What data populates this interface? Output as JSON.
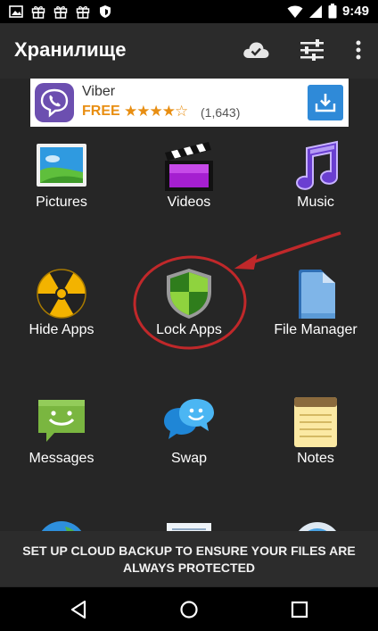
{
  "status_bar": {
    "time": "9:49",
    "left_icons": [
      "image-icon",
      "gift-icon",
      "gift-icon",
      "gift-icon",
      "shield-icon"
    ],
    "right_icons": [
      "wifi-icon",
      "signal-icon",
      "battery-icon"
    ]
  },
  "app_bar": {
    "title": "Хранилище",
    "actions": [
      "cloud-check-icon",
      "sliders-icon",
      "more-vertical-icon"
    ]
  },
  "ad": {
    "app_name": "Viber",
    "price": "FREE",
    "rating": 3.5,
    "rating_stars": "★★★★☆",
    "rating_count": "(1,643)"
  },
  "grid": [
    {
      "label": "Pictures",
      "icon": "pictures-icon"
    },
    {
      "label": "Videos",
      "icon": "videos-icon"
    },
    {
      "label": "Music",
      "icon": "music-icon"
    },
    {
      "label": "Hide Apps",
      "icon": "hide-apps-icon"
    },
    {
      "label": "Lock Apps",
      "icon": "lock-apps-icon"
    },
    {
      "label": "File Manager",
      "icon": "file-manager-icon"
    },
    {
      "label": "Messages",
      "icon": "messages-icon"
    },
    {
      "label": "Swap",
      "icon": "swap-icon"
    },
    {
      "label": "Notes",
      "icon": "notes-icon"
    }
  ],
  "snackbar": {
    "message": "SET UP CLOUD BACKUP TO ENSURE YOUR FILES ARE ALWAYS PROTECTED"
  },
  "nav_bar": [
    "back-icon",
    "home-icon",
    "recents-icon"
  ],
  "colors": {
    "annotation_red": "#c0282a",
    "ad_accent": "#e88e12",
    "viber_purple": "#6c4fb0",
    "download_blue": "#2f8ad8"
  }
}
